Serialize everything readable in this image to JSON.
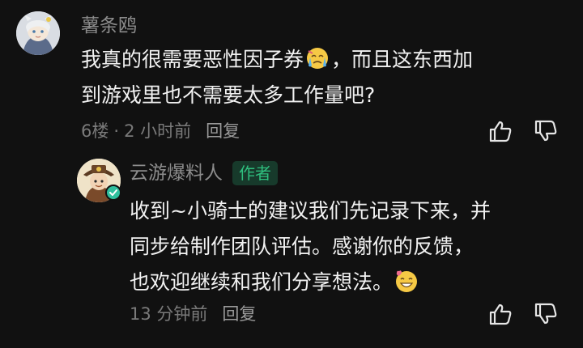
{
  "comment": {
    "username": "薯条鸥",
    "text_line1": "我真的很需要恶性因子券",
    "text_line1_after": "，而且这东西加",
    "text_line2": "到游戏里也不需要太多工作量吧?",
    "emoji_icon": "crying-face-icon",
    "floor": "6楼",
    "separator": "·",
    "time": "2 小时前",
    "reply_label": "回复",
    "like_icon": "thumbs-up-icon",
    "dislike_icon": "thumbs-down-icon"
  },
  "reply": {
    "username": "云游爆料人",
    "author_badge": "作者",
    "text_line1": "收到~小骑士的建议我们先记录下来，并",
    "text_line2": "同步给制作团队评估。感谢你的反馈，",
    "text_line3": "也欢迎继续和我们分享想法。",
    "emoji_icon": "grinning-face-with-heart-icon",
    "time": "13 分钟前",
    "reply_label": "回复",
    "verified_icon": "verified-check-icon",
    "like_icon": "thumbs-up-icon",
    "dislike_icon": "thumbs-down-icon"
  },
  "colors": {
    "background": "#111111",
    "text_primary": "#f1f1f1",
    "text_secondary": "#8c8c8c",
    "badge_bg": "#173a2b",
    "badge_text": "#2fbf7e"
  }
}
